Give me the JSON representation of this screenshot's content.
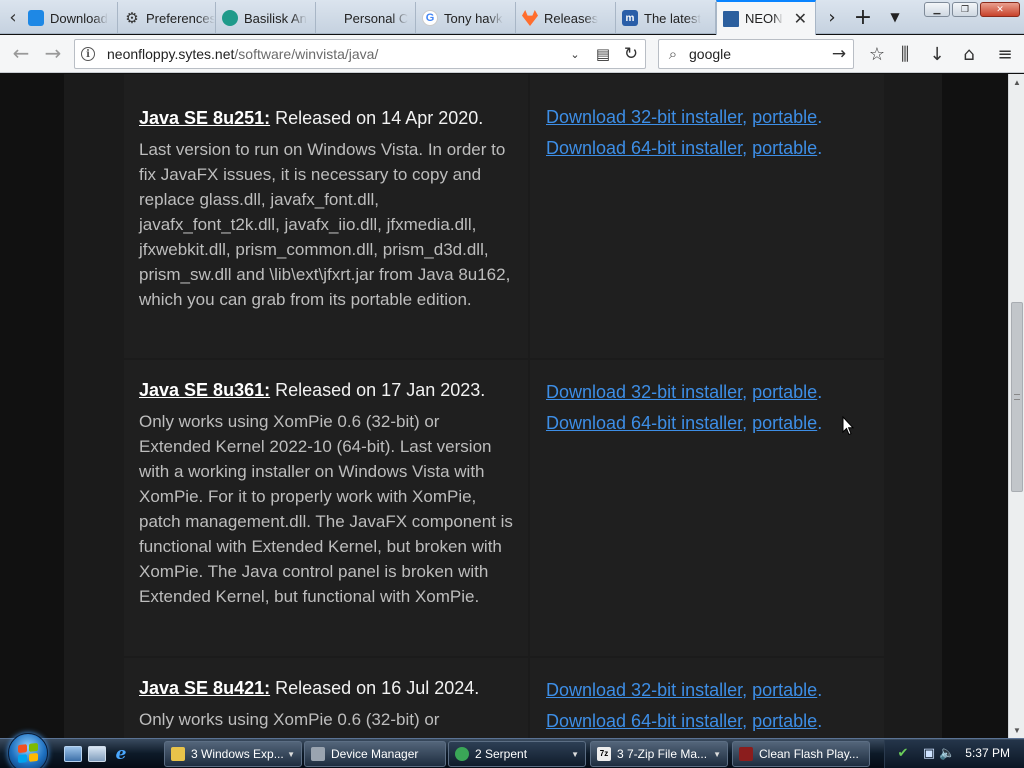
{
  "browser": {
    "tabs": [
      {
        "label": "Download",
        "favicon_color": "#1e88e5"
      },
      {
        "label": "Preferences",
        "favicon_color": "#444444"
      },
      {
        "label": "Basilisk An",
        "favicon_color": "#1f9a8a"
      },
      {
        "label": "Personal C",
        "favicon_color": "#f25022"
      },
      {
        "label": "Tony havk",
        "favicon_color": "#4285f4"
      },
      {
        "label": "Releases",
        "favicon_color": "#ff6d2d"
      },
      {
        "label": "The latest",
        "favicon_color": "#2a5ea8"
      },
      {
        "label": "NEONFLOPPY",
        "favicon_color": "#2c5f9e"
      }
    ],
    "url_host": "neonfloppy.sytes.net",
    "url_path": "/software/winvista/java/",
    "search_text": "google"
  },
  "entries": [
    {
      "version": "Java SE 8u251:",
      "released": "Released on 14 Apr 2020.",
      "description": "Last version to run on Windows Vista. In order to fix JavaFX issues, it is necessary to copy and replace glass.dll, javafx_font.dll, javafx_font_t2k.dll, javafx_iio.dll, jfxmedia.dll, jfxwebkit.dll, prism_common.dll, prism_d3d.dll, prism_sw.dll and \\lib\\ext\\jfxrt.jar from Java 8u162, which you can grab from its portable edition.",
      "dl32": "Download 32-bit installer",
      "dl64": "Download 64-bit installer",
      "portable": "portable"
    },
    {
      "version": "Java SE 8u361:",
      "released": "Released on 17 Jan 2023.",
      "description": "Only works using XomPie 0.6 (32-bit) or Extended Kernel 2022-10 (64-bit). Last version with a working installer on Windows Vista with XomPie. For it to properly work with XomPie, patch management.dll. The JavaFX component is functional with Extended Kernel, but broken with XomPie. The Java control panel is broken with Extended Kernel, but functional with XomPie.",
      "dl32": "Download 32-bit installer",
      "dl64": "Download 64-bit installer",
      "portable": "portable"
    },
    {
      "version": "Java SE 8u421:",
      "released": "Released on 16 Jul 2024.",
      "description": "Only works using XomPie 0.6 (32-bit) or",
      "dl32": "Download 32-bit installer",
      "dl64": "Download 64-bit installer",
      "portable": "portable"
    }
  ],
  "scrollbar": {
    "position": 0.48,
    "visible_fraction": 0.3
  },
  "taskbar": {
    "items": [
      {
        "label": "3 Windows Exp...",
        "icon_color": "#e8c34a",
        "has_dropdown": true
      },
      {
        "label": "Device Manager",
        "icon_color": "#9aa4b0",
        "has_dropdown": false
      },
      {
        "label": "2 Serpent",
        "icon_color": "#3aa657",
        "has_dropdown": true
      },
      {
        "label": "3 7-Zip File Ma...",
        "icon_color": "#222222",
        "has_dropdown": true
      },
      {
        "label": "Clean Flash Play...",
        "icon_color": "#8b1d1d",
        "has_dropdown": false
      }
    ],
    "clock": "5:37 PM"
  }
}
